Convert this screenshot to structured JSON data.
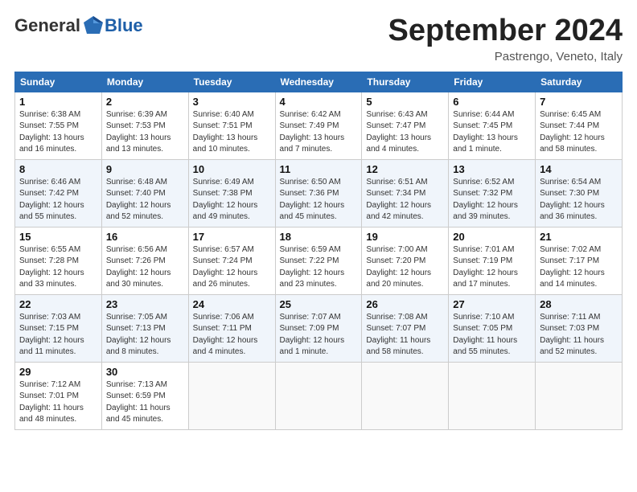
{
  "logo": {
    "general": "General",
    "blue": "Blue"
  },
  "header": {
    "month": "September 2024",
    "location": "Pastrengo, Veneto, Italy"
  },
  "weekdays": [
    "Sunday",
    "Monday",
    "Tuesday",
    "Wednesday",
    "Thursday",
    "Friday",
    "Saturday"
  ],
  "weeks": [
    [
      {
        "day": "1",
        "info": "Sunrise: 6:38 AM\nSunset: 7:55 PM\nDaylight: 13 hours\nand 16 minutes."
      },
      {
        "day": "2",
        "info": "Sunrise: 6:39 AM\nSunset: 7:53 PM\nDaylight: 13 hours\nand 13 minutes."
      },
      {
        "day": "3",
        "info": "Sunrise: 6:40 AM\nSunset: 7:51 PM\nDaylight: 13 hours\nand 10 minutes."
      },
      {
        "day": "4",
        "info": "Sunrise: 6:42 AM\nSunset: 7:49 PM\nDaylight: 13 hours\nand 7 minutes."
      },
      {
        "day": "5",
        "info": "Sunrise: 6:43 AM\nSunset: 7:47 PM\nDaylight: 13 hours\nand 4 minutes."
      },
      {
        "day": "6",
        "info": "Sunrise: 6:44 AM\nSunset: 7:45 PM\nDaylight: 13 hours\nand 1 minute."
      },
      {
        "day": "7",
        "info": "Sunrise: 6:45 AM\nSunset: 7:44 PM\nDaylight: 12 hours\nand 58 minutes."
      }
    ],
    [
      {
        "day": "8",
        "info": "Sunrise: 6:46 AM\nSunset: 7:42 PM\nDaylight: 12 hours\nand 55 minutes."
      },
      {
        "day": "9",
        "info": "Sunrise: 6:48 AM\nSunset: 7:40 PM\nDaylight: 12 hours\nand 52 minutes."
      },
      {
        "day": "10",
        "info": "Sunrise: 6:49 AM\nSunset: 7:38 PM\nDaylight: 12 hours\nand 49 minutes."
      },
      {
        "day": "11",
        "info": "Sunrise: 6:50 AM\nSunset: 7:36 PM\nDaylight: 12 hours\nand 45 minutes."
      },
      {
        "day": "12",
        "info": "Sunrise: 6:51 AM\nSunset: 7:34 PM\nDaylight: 12 hours\nand 42 minutes."
      },
      {
        "day": "13",
        "info": "Sunrise: 6:52 AM\nSunset: 7:32 PM\nDaylight: 12 hours\nand 39 minutes."
      },
      {
        "day": "14",
        "info": "Sunrise: 6:54 AM\nSunset: 7:30 PM\nDaylight: 12 hours\nand 36 minutes."
      }
    ],
    [
      {
        "day": "15",
        "info": "Sunrise: 6:55 AM\nSunset: 7:28 PM\nDaylight: 12 hours\nand 33 minutes."
      },
      {
        "day": "16",
        "info": "Sunrise: 6:56 AM\nSunset: 7:26 PM\nDaylight: 12 hours\nand 30 minutes."
      },
      {
        "day": "17",
        "info": "Sunrise: 6:57 AM\nSunset: 7:24 PM\nDaylight: 12 hours\nand 26 minutes."
      },
      {
        "day": "18",
        "info": "Sunrise: 6:59 AM\nSunset: 7:22 PM\nDaylight: 12 hours\nand 23 minutes."
      },
      {
        "day": "19",
        "info": "Sunrise: 7:00 AM\nSunset: 7:20 PM\nDaylight: 12 hours\nand 20 minutes."
      },
      {
        "day": "20",
        "info": "Sunrise: 7:01 AM\nSunset: 7:19 PM\nDaylight: 12 hours\nand 17 minutes."
      },
      {
        "day": "21",
        "info": "Sunrise: 7:02 AM\nSunset: 7:17 PM\nDaylight: 12 hours\nand 14 minutes."
      }
    ],
    [
      {
        "day": "22",
        "info": "Sunrise: 7:03 AM\nSunset: 7:15 PM\nDaylight: 12 hours\nand 11 minutes."
      },
      {
        "day": "23",
        "info": "Sunrise: 7:05 AM\nSunset: 7:13 PM\nDaylight: 12 hours\nand 8 minutes."
      },
      {
        "day": "24",
        "info": "Sunrise: 7:06 AM\nSunset: 7:11 PM\nDaylight: 12 hours\nand 4 minutes."
      },
      {
        "day": "25",
        "info": "Sunrise: 7:07 AM\nSunset: 7:09 PM\nDaylight: 12 hours\nand 1 minute."
      },
      {
        "day": "26",
        "info": "Sunrise: 7:08 AM\nSunset: 7:07 PM\nDaylight: 11 hours\nand 58 minutes."
      },
      {
        "day": "27",
        "info": "Sunrise: 7:10 AM\nSunset: 7:05 PM\nDaylight: 11 hours\nand 55 minutes."
      },
      {
        "day": "28",
        "info": "Sunrise: 7:11 AM\nSunset: 7:03 PM\nDaylight: 11 hours\nand 52 minutes."
      }
    ],
    [
      {
        "day": "29",
        "info": "Sunrise: 7:12 AM\nSunset: 7:01 PM\nDaylight: 11 hours\nand 48 minutes."
      },
      {
        "day": "30",
        "info": "Sunrise: 7:13 AM\nSunset: 6:59 PM\nDaylight: 11 hours\nand 45 minutes."
      },
      {
        "day": "",
        "info": ""
      },
      {
        "day": "",
        "info": ""
      },
      {
        "day": "",
        "info": ""
      },
      {
        "day": "",
        "info": ""
      },
      {
        "day": "",
        "info": ""
      }
    ]
  ]
}
